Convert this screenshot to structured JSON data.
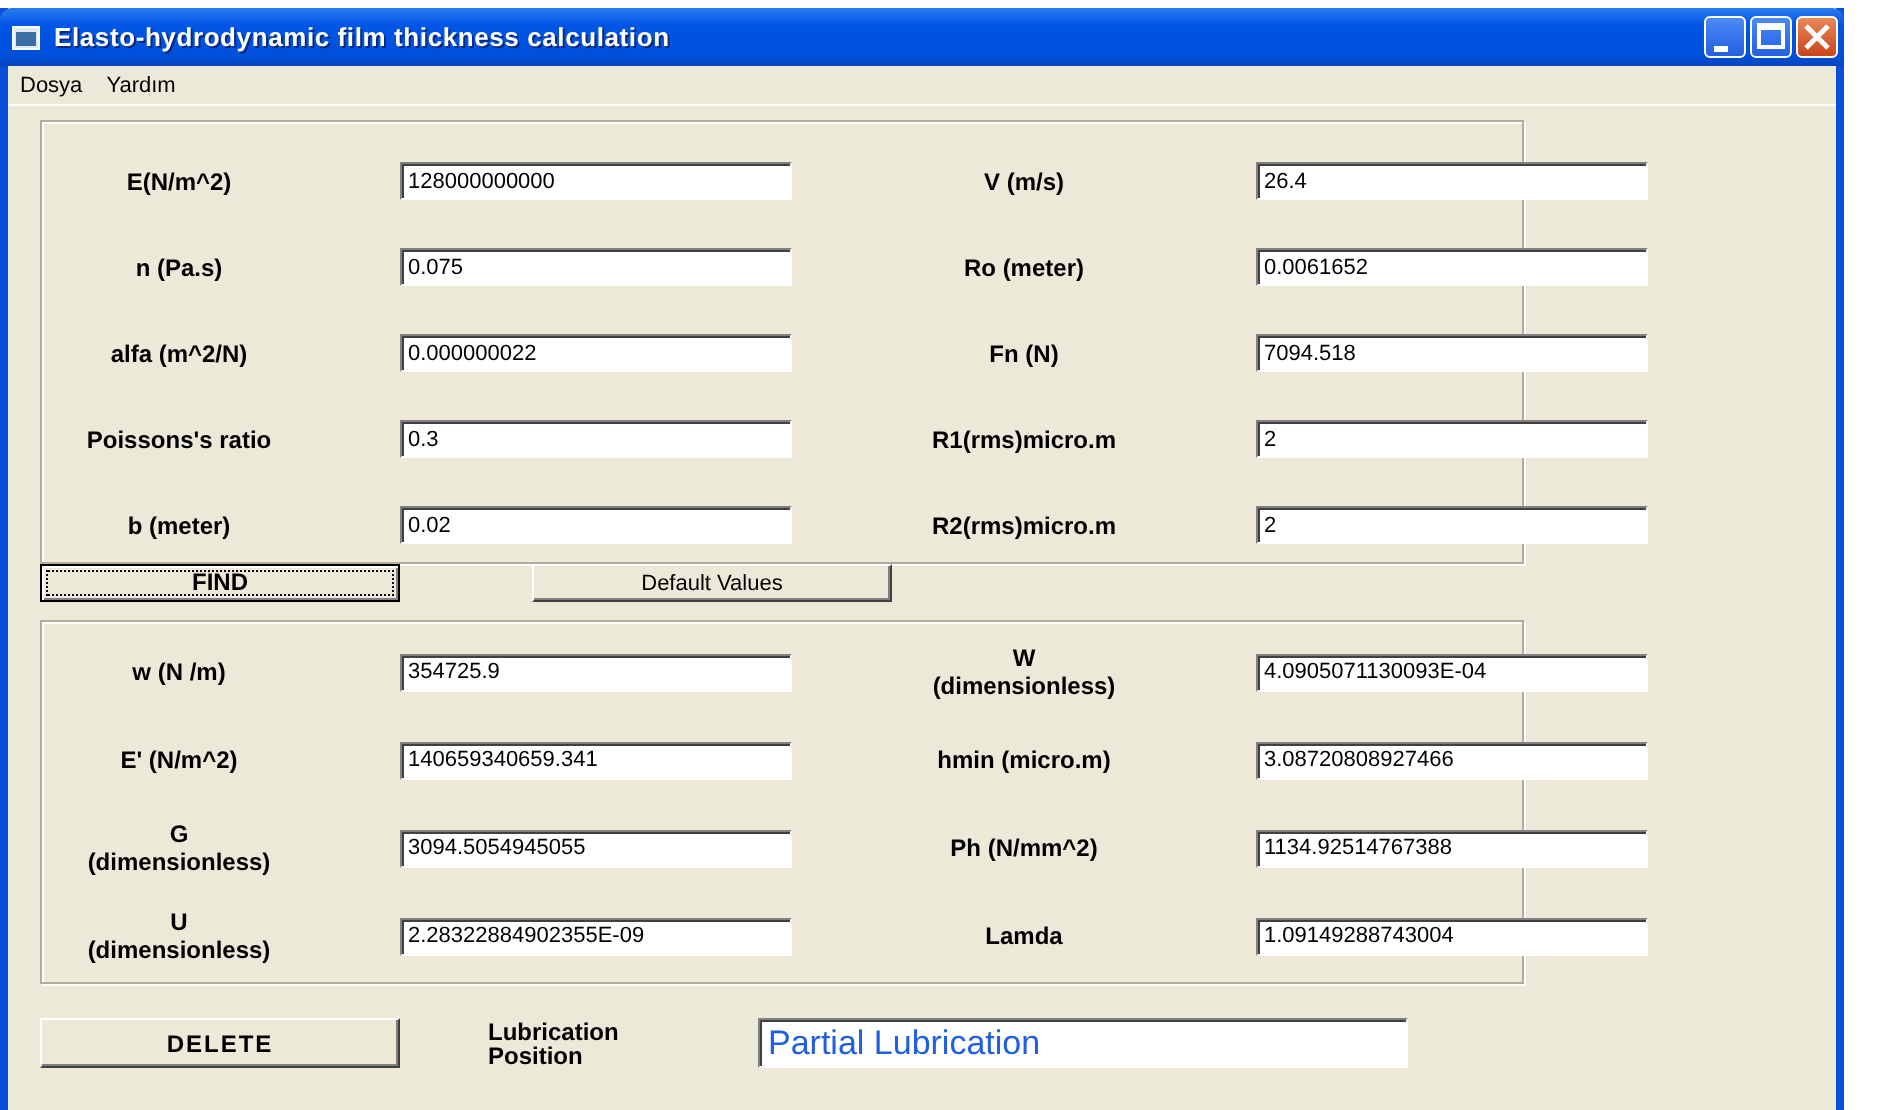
{
  "window": {
    "title": "Elasto-hydrodynamic film thickness calculation"
  },
  "menu": [
    "Dosya",
    "Yardım"
  ],
  "inputs": [
    {
      "label": "E(N/m^2)",
      "value": "128000000000"
    },
    {
      "label": "V (m/s)",
      "value": "26.4"
    },
    {
      "label": "n (Pa.s)",
      "value": "0.075"
    },
    {
      "label": "Ro (meter)",
      "value": "0.0061652"
    },
    {
      "label": "alfa (m^2/N)",
      "value": "0.000000022"
    },
    {
      "label": "Fn (N)",
      "value": "7094.518"
    },
    {
      "label": "Poissons's ratio",
      "value": "0.3"
    },
    {
      "label": "R1(rms)micro.m",
      "value": "2"
    },
    {
      "label": "b (meter)",
      "value": "0.02"
    },
    {
      "label": "R2(rms)micro.m",
      "value": "2"
    }
  ],
  "buttons": [
    {
      "label": "FIND",
      "focused": true
    },
    {
      "label": "Default Values",
      "focused": false
    }
  ],
  "outputs": [
    {
      "label": "w (N /m)",
      "value": "354725.9"
    },
    {
      "label": "W (dimensionless)",
      "value": "4.0905071130093E-04"
    },
    {
      "label": "E' (N/m^2)",
      "value": "140659340659.341"
    },
    {
      "label": "hmin (micro.m)",
      "value": "3.08720808927466"
    },
    {
      "label": "G (dimensionless)",
      "value": "3094.5054945055"
    },
    {
      "label": "Ph (N/mm^2)",
      "value": "1134.92514767388"
    },
    {
      "label": "U (dimensionless)",
      "value": "2.28322884902355E-09"
    },
    {
      "label": "Lamda",
      "value": "1.09149288743004"
    }
  ],
  "delete_button": "DELETE",
  "result": {
    "label": "Lubrication Position",
    "value": "Partial Lubrication"
  }
}
